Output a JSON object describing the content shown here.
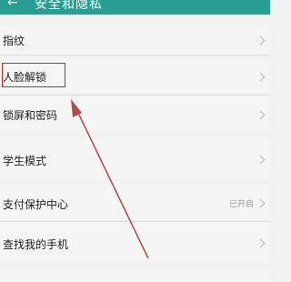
{
  "header": {
    "title": "安全和隐私",
    "back_icon": "back-arrow-icon"
  },
  "items": [
    {
      "label": "指纹"
    },
    {
      "label": "人脸解锁"
    },
    {
      "label": "锁屏和密码"
    },
    {
      "label": "学生模式"
    },
    {
      "label": "支付保护中心",
      "status": "已开启"
    },
    {
      "label": "查找我的手机"
    },
    {
      "label": ""
    }
  ],
  "annotation": {
    "color": "#c62828"
  },
  "colors": {
    "header": "#279e94",
    "background": "#f1f2f1"
  }
}
